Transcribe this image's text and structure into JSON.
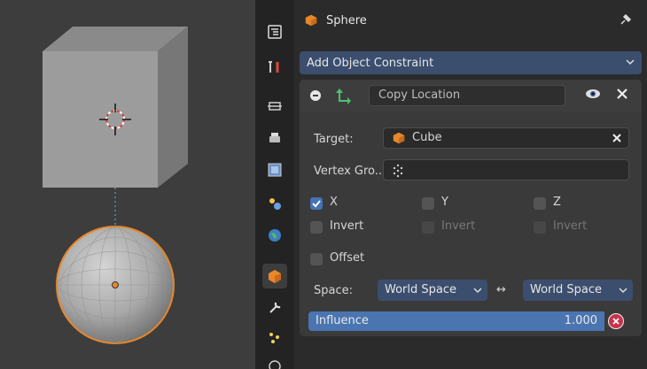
{
  "header": {
    "object_name": "Sphere"
  },
  "add_constraint": {
    "label": "Add Object Constraint"
  },
  "constraint": {
    "name": "Copy Location",
    "target_label": "Target:",
    "target_value": "Cube",
    "vertex_group_label": "Vertex Gro..",
    "axes": [
      {
        "label": "X",
        "checked": true
      },
      {
        "label": "Y",
        "checked": false
      },
      {
        "label": "Z",
        "checked": false
      }
    ],
    "invert_label": "Invert",
    "offset_label": "Offset",
    "space_label": "Space:",
    "owner_space": "World Space",
    "target_space": "World Space",
    "space_arrow": "↔",
    "influence_label": "Influence",
    "influence_value": "1.000"
  },
  "colors": {
    "accent_blue": "#4772b3",
    "dropdown_blue": "#3b4e6e",
    "influence_blue": "#4a75b0",
    "object_orange": "#e8872a",
    "reset_red": "#c8324a"
  }
}
